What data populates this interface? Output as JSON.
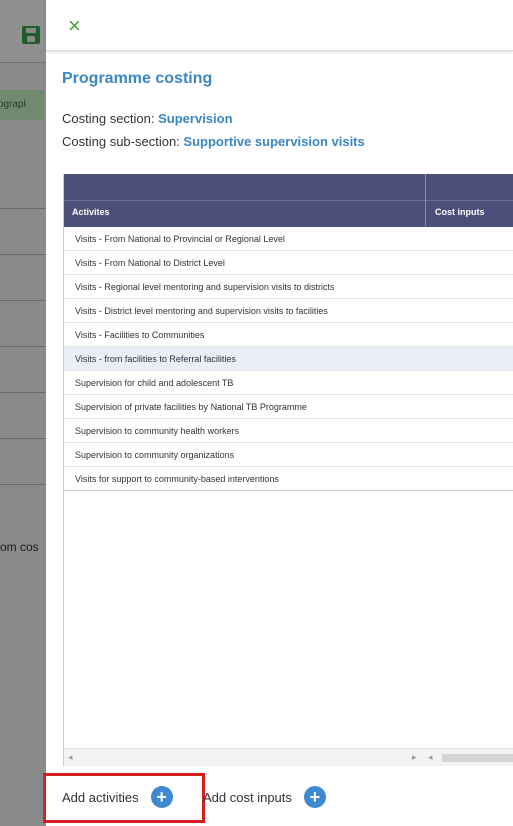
{
  "background": {
    "pill_text": "ograpl",
    "text_fragment": "om cos"
  },
  "panel": {
    "close_icon": "×",
    "title": "Programme costing",
    "costing_section_label": "Costing section:",
    "costing_section_value": "Supervision",
    "costing_subsection_label": "Costing sub-section:",
    "costing_subsection_value": "Supportive supervision visits"
  },
  "grid": {
    "columns": [
      "Activites",
      "Cost inputs"
    ],
    "rows": [
      "Visits - From National to Provincial or Regional Level",
      "Visits - From National to District Level",
      "Visits - Regional level mentoring and supervision visits to districts",
      "Visits - District level mentoring and supervision visits to facilities",
      "Visits - Facilities to Communities",
      "Visits - from facilities to Referral facilities",
      "Supervision for child and adolescent TB",
      "Supervision of private facilities by National TB Programme",
      "Supervision to community health workers",
      "Supervision to community organizations",
      "Visits for support to community-based interventions"
    ],
    "selected_row_index": 5
  },
  "footer": {
    "add_activities_label": "Add activities",
    "add_cost_inputs_label": "Add cost inputs",
    "plus_icon": "+"
  },
  "colors": {
    "accent": "#3b86c6",
    "header": "#4b4f7a",
    "close": "#4aa23e",
    "highlight": "#d62020"
  }
}
